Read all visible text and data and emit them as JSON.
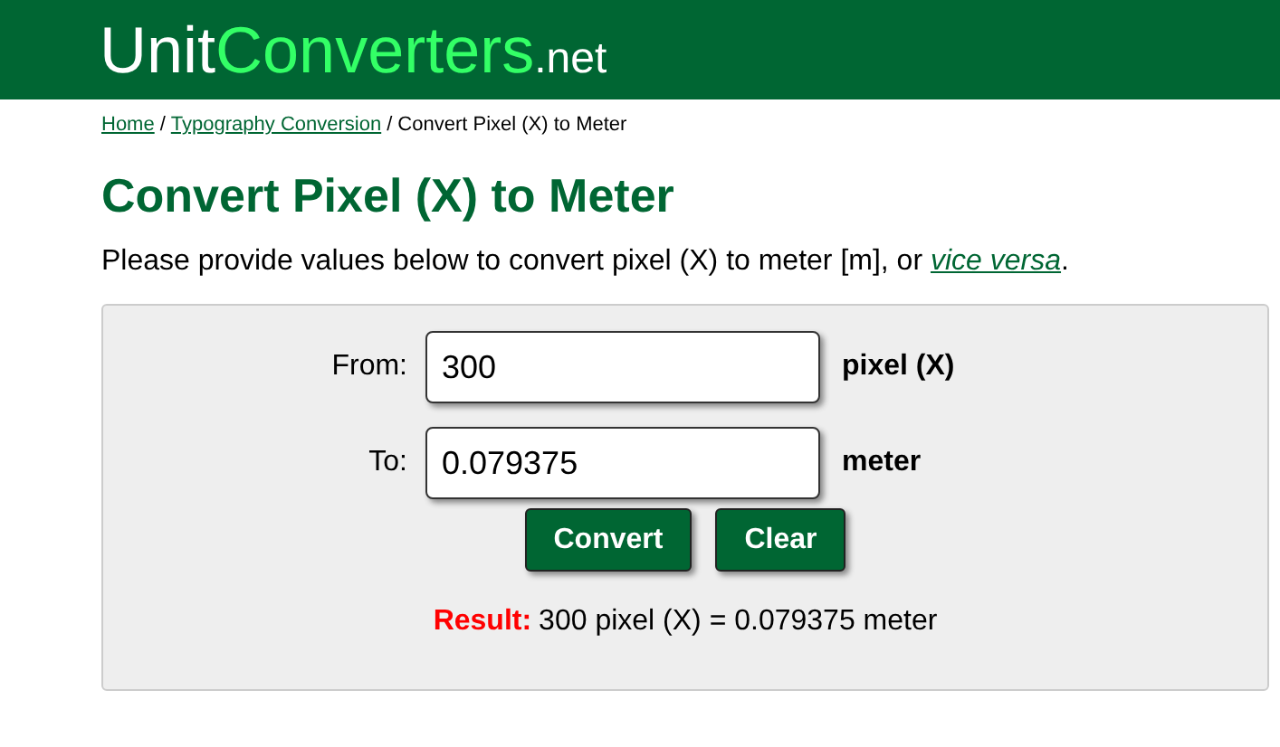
{
  "logo": {
    "first": "Unit",
    "second": "Converters",
    "suffix": ".net"
  },
  "breadcrumb_separator": "/",
  "breadcrumb": [
    {
      "label": "Home",
      "link": true
    },
    {
      "label": "Typography Conversion",
      "link": true
    },
    {
      "label": "Convert Pixel (X) to Meter",
      "link": false
    }
  ],
  "title": "Convert Pixel (X) to Meter",
  "intro": {
    "before": "Please provide values below to convert pixel (X) to meter [m], or",
    "link": "vice versa",
    "after": "."
  },
  "form": {
    "rows": [
      {
        "label": "From:",
        "value": "300",
        "unit": "pixel (X)"
      },
      {
        "label": "To:",
        "value": "0.079375",
        "unit": "meter"
      }
    ],
    "buttons": [
      "Convert",
      "Clear"
    ],
    "result": {
      "label": "Result:",
      "text": "300 pixel (X) = 0.079375 meter"
    }
  }
}
